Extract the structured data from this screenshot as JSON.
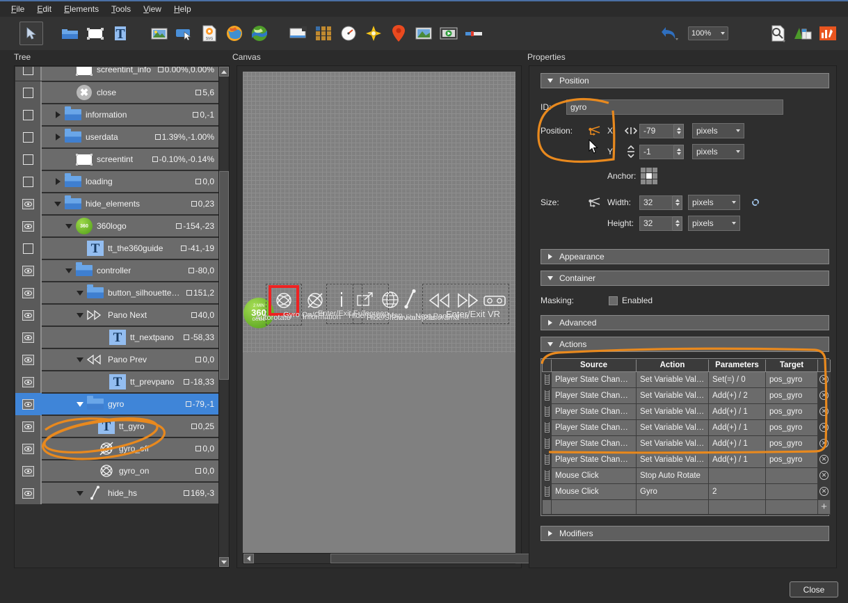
{
  "menubar": [
    "File",
    "Edit",
    "Elements",
    "Tools",
    "View",
    "Help"
  ],
  "toolbar": {
    "zoom_value": "100%",
    "icons": [
      "select-arrow-icon",
      "folder-icon",
      "rectangle-icon",
      "text-icon",
      "image-icon",
      "button-icon",
      "svg-icon",
      "globe-icon",
      "map-icon",
      "window-icon",
      "grid-icon",
      "gauge-icon",
      "compass-icon",
      "pin-icon",
      "thumbnail-icon",
      "video-icon",
      "slider-icon",
      "undo-icon",
      "zoom-preview-icon",
      "skin-icon",
      "tools-icon"
    ]
  },
  "panels": {
    "tree_label": "Tree",
    "canvas_label": "Canvas",
    "properties_label": "Properties"
  },
  "tree": {
    "rows": [
      {
        "vis": "box",
        "indent": 2,
        "twisty": "none",
        "icon": "rect",
        "label": "screentint_info",
        "coord": "0.00%,0.00%",
        "selected": false,
        "clipped": true
      },
      {
        "vis": "box",
        "indent": 2,
        "twisty": "none",
        "icon": "close",
        "label": "close",
        "coord": "5,6",
        "selected": false
      },
      {
        "vis": "box",
        "indent": 1,
        "twisty": "closed",
        "icon": "folder",
        "label": "information",
        "coord": "0,-1",
        "selected": false
      },
      {
        "vis": "box",
        "indent": 1,
        "twisty": "closed",
        "icon": "folder",
        "label": "userdata",
        "coord": "1.39%,-1.00%",
        "selected": false
      },
      {
        "vis": "box",
        "indent": 2,
        "twisty": "none",
        "icon": "rect",
        "label": "screentint",
        "coord": "-0.10%,-0.14%",
        "selected": false
      },
      {
        "vis": "box",
        "indent": 1,
        "twisty": "closed",
        "icon": "folder",
        "label": "loading",
        "coord": "0,0",
        "selected": false
      },
      {
        "vis": "eye",
        "indent": 1,
        "twisty": "open",
        "icon": "folder",
        "label": "hide_elements",
        "coord": "0,23",
        "selected": false
      },
      {
        "vis": "eye",
        "indent": 2,
        "twisty": "open",
        "icon": "logo",
        "label": "360logo",
        "coord": "-154,-23",
        "selected": false
      },
      {
        "vis": "box",
        "indent": 3,
        "twisty": "none",
        "icon": "text",
        "label": "tt_the360guide",
        "coord": "-41,-19",
        "selected": false
      },
      {
        "vis": "eye",
        "indent": 2,
        "twisty": "open",
        "icon": "folder",
        "label": "controller",
        "coord": "-80,0",
        "selected": false
      },
      {
        "vis": "eye",
        "indent": 3,
        "twisty": "open",
        "icon": "folder",
        "label": "button_silhouette_...",
        "coord": "151,2",
        "selected": false
      },
      {
        "vis": "eye",
        "indent": 3,
        "twisty": "open",
        "icon": "next",
        "label": "Pano Next",
        "coord": "40,0",
        "selected": false
      },
      {
        "vis": "eye",
        "indent": 5,
        "twisty": "none",
        "icon": "text",
        "label": "tt_nextpano",
        "coord": "-58,33",
        "selected": false
      },
      {
        "vis": "eye",
        "indent": 3,
        "twisty": "open",
        "icon": "prev",
        "label": "Pano Prev",
        "coord": "0,0",
        "selected": false
      },
      {
        "vis": "eye",
        "indent": 5,
        "twisty": "none",
        "icon": "text",
        "label": "tt_prevpano",
        "coord": "-18,33",
        "selected": false
      },
      {
        "vis": "eye",
        "indent": 3,
        "twisty": "open",
        "icon": "folder",
        "label": "gyro",
        "coord": "-79,-1",
        "selected": true
      },
      {
        "vis": "eye",
        "indent": 4,
        "twisty": "none",
        "icon": "text",
        "label": "tt_gyro",
        "coord": "0,25",
        "selected": false
      },
      {
        "vis": "eye",
        "indent": 4,
        "twisty": "none",
        "icon": "gyrooff",
        "label": "gyro_off",
        "coord": "0,0",
        "selected": false
      },
      {
        "vis": "eye",
        "indent": 4,
        "twisty": "none",
        "icon": "gyroon",
        "label": "gyro_on",
        "coord": "0,0",
        "selected": false
      },
      {
        "vis": "eye",
        "indent": 3,
        "twisty": "open",
        "icon": "hs",
        "label": "hide_hs",
        "coord": "169,-3",
        "selected": false
      }
    ]
  },
  "canvas": {
    "logo_lines": [
      "2 MIN",
      "360",
      "GUIDE"
    ],
    "items": [
      {
        "icon": "gyro-on-icon",
        "caption": "Autorotate",
        "selected": true
      },
      {
        "icon": "gyro-off-icon",
        "caption": "Gyro On/Off",
        "selected": false
      },
      {
        "icon": "info-icon",
        "caption": "Information",
        "selected": false
      },
      {
        "icon": "fullscreen-icon",
        "caption": "Enter/Exit Fullscreen",
        "selected": false
      },
      {
        "icon": "globe-icon",
        "caption": "Hide/Show Map",
        "selected": false
      },
      {
        "icon": "hotspot-icon",
        "caption": "Hide/Show Hotspots",
        "selected": false
      },
      {
        "icon": "prev-icon",
        "caption": "Previous Panorama",
        "selected": false
      },
      {
        "icon": "next-icon",
        "caption": "Next Panorama",
        "selected": false
      },
      {
        "icon": "vr-icon",
        "caption": "Enter/Exit VR",
        "selected": false
      }
    ]
  },
  "properties": {
    "sections": {
      "position": "Position",
      "appearance": "Appearance",
      "container": "Container",
      "advanced": "Advanced",
      "actions": "Actions",
      "modifiers": "Modifiers"
    },
    "position": {
      "id_label": "ID:",
      "id_value": "gyro",
      "position_label": "Position:",
      "x_label": "X:",
      "x_value": "-79",
      "x_unit": "pixels",
      "y_label": "Y:",
      "y_value": "-1",
      "y_unit": "pixels",
      "anchor_label": "Anchor:",
      "size_label": "Size:",
      "width_label": "Width:",
      "width_value": "32",
      "width_unit": "pixels",
      "height_label": "Height:",
      "height_value": "32",
      "height_unit": "pixels"
    },
    "container": {
      "masking_label": "Masking:",
      "enabled_label": "Enabled",
      "enabled_checked": false
    },
    "actions": {
      "columns": [
        "Source",
        "Action",
        "Parameters",
        "Target"
      ],
      "rows": [
        {
          "source": "Player State Changed",
          "action": "Set Variable Value",
          "parameters": "Set(=) / 0",
          "target": "pos_gyro"
        },
        {
          "source": "Player State Changed*",
          "action": "Set Variable Value",
          "parameters": "Add(+) / 2",
          "target": "pos_gyro"
        },
        {
          "source": "Player State Changed*",
          "action": "Set Variable Value",
          "parameters": "Add(+) / 1",
          "target": "pos_gyro"
        },
        {
          "source": "Player State Changed*",
          "action": "Set Variable Value",
          "parameters": "Add(+) / 1",
          "target": "pos_gyro"
        },
        {
          "source": "Player State Changed*",
          "action": "Set Variable Value",
          "parameters": "Add(+) / 1",
          "target": "pos_gyro"
        },
        {
          "source": "Player State Changed*",
          "action": "Set Variable Value",
          "parameters": "Add(+) / 1",
          "target": "pos_gyro"
        },
        {
          "source": "Mouse Click",
          "action": "Stop Auto Rotate",
          "parameters": "",
          "target": ""
        },
        {
          "source": "Mouse Click",
          "action": "Gyro",
          "parameters": "2",
          "target": ""
        }
      ],
      "add_label": "+"
    }
  },
  "footer": {
    "close_label": "Close"
  },
  "colors": {
    "window_bg": "#2b2b2b",
    "panel_bg": "#2e2e2e",
    "row_bg": "#6b6b6b",
    "selection_blue": "#3f85d8",
    "annotation_orange": "#e8891e",
    "canvas_selection_red": "#ee2222",
    "accent_blue": "#4a6fa5"
  }
}
